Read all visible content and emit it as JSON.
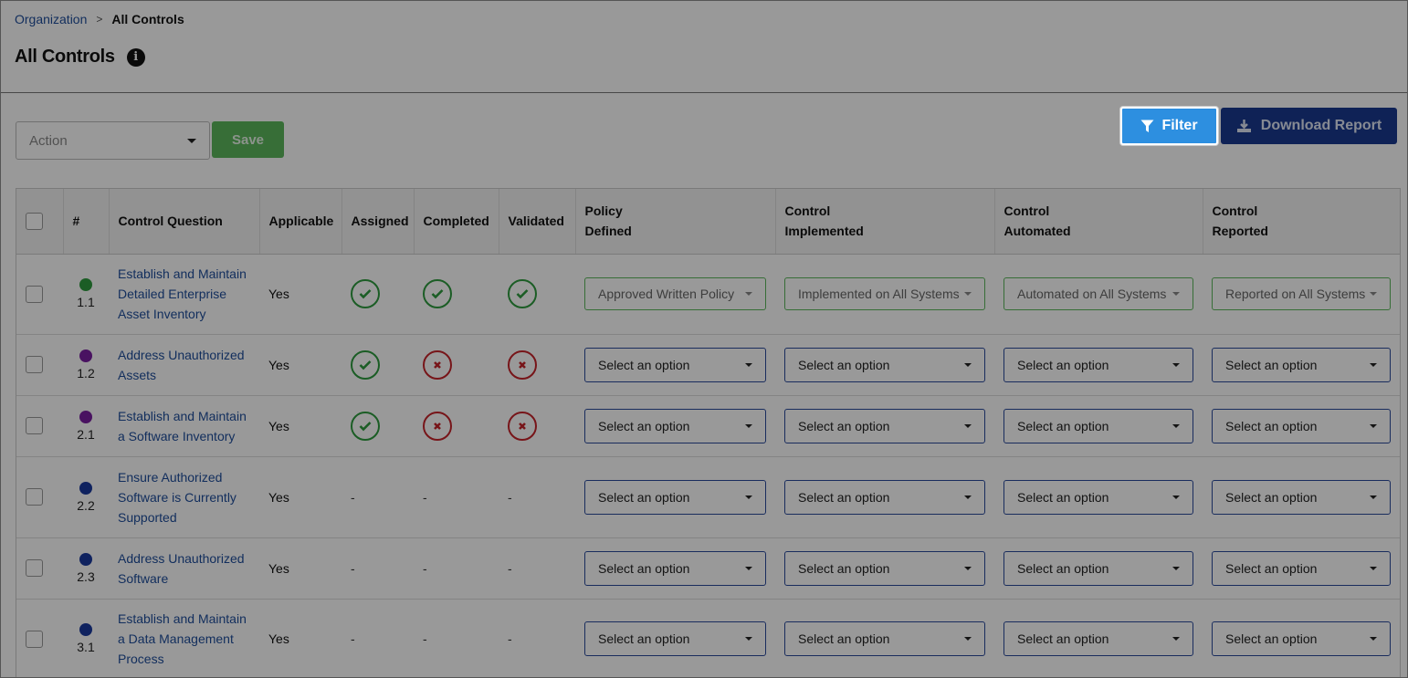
{
  "breadcrumb": {
    "parent": "Organization",
    "separator": ">",
    "current": "All Controls"
  },
  "page": {
    "title": "All Controls",
    "info_icon": "info-icon"
  },
  "toolbar": {
    "action_placeholder": "Action",
    "save_label": "Save",
    "filter_label": "Filter",
    "download_label": "Download Report"
  },
  "table": {
    "columns": {
      "number": "#",
      "question": "Control Question",
      "applicable": "Applicable",
      "assigned": "Assigned",
      "completed": "Completed",
      "validated": "Validated",
      "policy_line1": "Policy",
      "policy_line2": "Defined",
      "implemented_line1": "Control",
      "implemented_line2": "Implemented",
      "automated_line1": "Control",
      "automated_line2": "Automated",
      "reported_line1": "Control",
      "reported_line2": "Reported"
    },
    "rows": [
      {
        "number": "1.1",
        "dot_color": "#2e9b3e",
        "question_lines": [
          "Establish and Maintain",
          "Detailed Enterprise",
          "Asset Inventory"
        ],
        "applicable": "Yes",
        "assigned": "check",
        "completed": "check",
        "validated": "check",
        "policy": "Approved Written Policy",
        "implemented": "Implemented on All Systems",
        "automated": "Automated on All Systems",
        "reported": "Reported on All Systems",
        "set": true
      },
      {
        "number": "1.2",
        "dot_color": "#7a1fa2",
        "question_lines": [
          "Address Unauthorized",
          "Assets"
        ],
        "applicable": "Yes",
        "assigned": "check",
        "completed": "cross",
        "validated": "cross",
        "policy": "Select an option",
        "implemented": "Select an option",
        "automated": "Select an option",
        "reported": "Select an option",
        "set": false
      },
      {
        "number": "2.1",
        "dot_color": "#7a1fa2",
        "question_lines": [
          "Establish and Maintain",
          "a Software Inventory"
        ],
        "applicable": "Yes",
        "assigned": "check",
        "completed": "cross",
        "validated": "cross",
        "policy": "Select an option",
        "implemented": "Select an option",
        "automated": "Select an option",
        "reported": "Select an option",
        "set": false
      },
      {
        "number": "2.2",
        "dot_color": "#1a3a9f",
        "question_lines": [
          "Ensure Authorized",
          "Software is Currently",
          "Supported"
        ],
        "applicable": "Yes",
        "assigned": "-",
        "completed": "-",
        "validated": "-",
        "policy": "Select an option",
        "implemented": "Select an option",
        "automated": "Select an option",
        "reported": "Select an option",
        "set": false
      },
      {
        "number": "2.3",
        "dot_color": "#1a3a9f",
        "question_lines": [
          "Address Unauthorized",
          "Software"
        ],
        "applicable": "Yes",
        "assigned": "-",
        "completed": "-",
        "validated": "-",
        "policy": "Select an option",
        "implemented": "Select an option",
        "automated": "Select an option",
        "reported": "Select an option",
        "set": false
      },
      {
        "number": "3.1",
        "dot_color": "#1a3a9f",
        "question_lines": [
          "Establish and Maintain",
          "a Data Management",
          "Process"
        ],
        "applicable": "Yes",
        "assigned": "-",
        "completed": "-",
        "validated": "-",
        "policy": "Select an option",
        "implemented": "Select an option",
        "automated": "Select an option",
        "reported": "Select an option",
        "set": false
      }
    ]
  },
  "overlay": {
    "color": "rgba(0,0,0,0.40)"
  }
}
